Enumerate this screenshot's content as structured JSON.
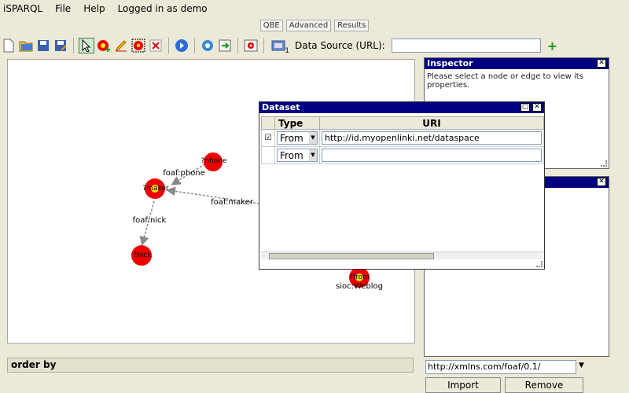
{
  "menu": {
    "app": "iSPARQL",
    "file": "File",
    "help": "Help",
    "login": "Logged in as demo"
  },
  "tabs": [
    {
      "label": "QBE"
    },
    {
      "label": "Advanced"
    },
    {
      "label": "Results"
    }
  ],
  "toolbar": {
    "data_source_label": "Data Source (URL):",
    "data_source_value": "",
    "add_label": "+",
    "badge": "1"
  },
  "graph": {
    "nodes": [
      {
        "label": "?phone"
      },
      {
        "label": "?maker"
      },
      {
        "label": "?nick"
      },
      {
        "label": "?from",
        "sublabel": "sioc:Weblog"
      }
    ],
    "edges": [
      {
        "label": "foaf:phone"
      },
      {
        "label": "foaf:nick"
      },
      {
        "label": "foaf:maker"
      }
    ]
  },
  "orderby": {
    "label": "order by"
  },
  "inspector": {
    "title": "Inspector",
    "message": "Please select a node or edge to view its properties.",
    "close": "✕"
  },
  "second_panel": {
    "close": "✕"
  },
  "dataset": {
    "title": "Dataset",
    "headers": {
      "type": "Type",
      "uri": "URI"
    },
    "rows": [
      {
        "checked": "☑",
        "type": "From",
        "uri": "http://id.myopenlinki.net/dataspace"
      },
      {
        "checked": "",
        "type": "From",
        "uri": ""
      }
    ]
  },
  "namespace": {
    "value": "http://xmlns.com/foaf/0.1/"
  },
  "buttons": {
    "import": "Import",
    "remove": "Remove"
  }
}
